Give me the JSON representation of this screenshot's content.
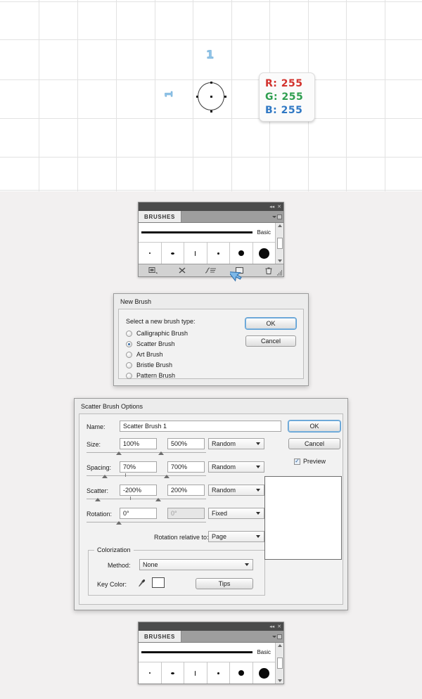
{
  "canvas": {
    "labels": {
      "top": "1",
      "left": "1"
    },
    "rgb_badge": {
      "r_label": "R:",
      "r_value": "255",
      "g_label": "G:",
      "g_value": "255",
      "b_label": "B:",
      "b_value": "255",
      "r_color": "#d2322d",
      "g_color": "#2e9e4f",
      "b_color": "#2f78c4"
    }
  },
  "brushes_panel": {
    "tab_label": "BRUSHES",
    "basic_label": "Basic",
    "swatch_count": 6,
    "footer_icons": [
      "brush-libraries-icon",
      "remove-brush-stroke-icon",
      "options-of-selected-object-icon",
      "new-brush-icon",
      "delete-brush-icon"
    ],
    "titlebar_icons": [
      "collapse-icon",
      "close-icon"
    ]
  },
  "new_brush_dialog": {
    "title": "New Brush",
    "prompt": "Select a new brush type:",
    "options": [
      {
        "label": "Calligraphic Brush",
        "selected": false
      },
      {
        "label": "Scatter Brush",
        "selected": true
      },
      {
        "label": "Art Brush",
        "selected": false
      },
      {
        "label": "Bristle Brush",
        "selected": false
      },
      {
        "label": "Pattern Brush",
        "selected": false
      }
    ],
    "ok_label": "OK",
    "cancel_label": "Cancel"
  },
  "scatter_dialog": {
    "title": "Scatter Brush Options",
    "name_label": "Name:",
    "name_value": "Scatter Brush 1",
    "rows": [
      {
        "label": "Size:",
        "min": "100%",
        "max": "500%",
        "mode": "Random"
      },
      {
        "label": "Spacing:",
        "min": "70%",
        "max": "700%",
        "mode": "Random"
      },
      {
        "label": "Scatter:",
        "min": "-200%",
        "max": "200%",
        "mode": "Random"
      },
      {
        "label": "Rotation:",
        "min": "0°",
        "max": "0°",
        "mode": "Fixed"
      }
    ],
    "rotation_relative_label": "Rotation relative to:",
    "rotation_relative_value": "Page",
    "colorization_legend": "Colorization",
    "method_label": "Method:",
    "method_value": "None",
    "key_color_label": "Key Color:",
    "key_color_value": "#ffffff",
    "tips_label": "Tips",
    "ok_label": "OK",
    "cancel_label": "Cancel",
    "preview_label": "Preview",
    "preview_checked": true
  },
  "brushes_panel_bottom": {
    "tab_label": "BRUSHES",
    "basic_label": "Basic"
  }
}
